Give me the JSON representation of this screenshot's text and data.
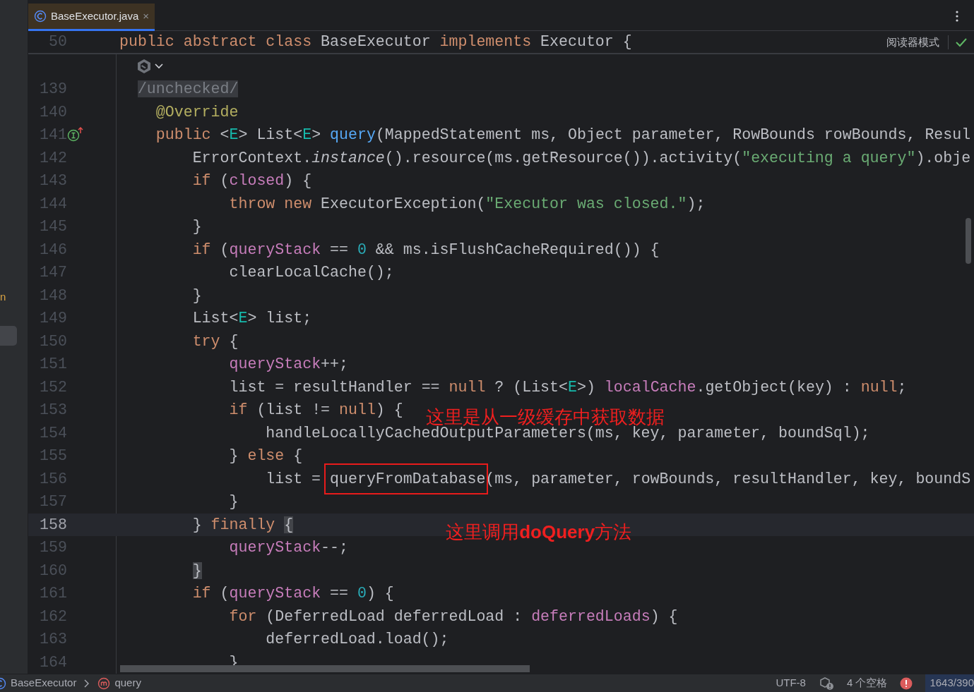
{
  "tab": {
    "title": "BaseExecutor.java",
    "close": "×",
    "selected": true
  },
  "left_panel": {
    "text": "n"
  },
  "sticky_header": {
    "line_number": "50",
    "tokens": [
      {
        "t": "public abstract class",
        "kind": "kw"
      },
      {
        "t": " BaseExecutor ",
        "kind": "plain"
      },
      {
        "t": "implements",
        "kind": "kw"
      },
      {
        "t": " Executor {",
        "kind": "plain"
      }
    ],
    "reader_mode": "阅读器模式"
  },
  "lines": [
    {
      "number": "139",
      "current": false,
      "tokens": [
        {
          "t": "/unchecked/",
          "kind": "fold"
        }
      ]
    },
    {
      "number": "140",
      "current": false,
      "tokens": [
        {
          "t": "@Override",
          "kind": "annot"
        }
      ]
    },
    {
      "number": "141",
      "current": false,
      "gutter_icon": {
        "kind": "implements"
      },
      "tokens": [
        {
          "t": "public",
          "kind": "kw"
        },
        {
          "t": " <",
          "kind": "plain"
        },
        {
          "t": "E",
          "kind": "tparam"
        },
        {
          "t": "> List<",
          "kind": "plain"
        },
        {
          "t": "E",
          "kind": "tparam"
        },
        {
          "t": "> ",
          "kind": "plain"
        },
        {
          "t": "query",
          "kind": "method"
        },
        {
          "t": "(MappedStatement ms, Object parameter, RowBounds rowBounds, Resul",
          "kind": "plain"
        }
      ],
      "children": [
        {
          "number": "142",
          "current": false,
          "tokens": [
            {
              "t": "ErrorContext.",
              "kind": "plain"
            },
            {
              "t": "instance",
              "kind": "italic"
            },
            {
              "t": "().resource(ms.getResource()).activity(",
              "kind": "plain"
            },
            {
              "t": "\"executing a query\"",
              "kind": "str"
            },
            {
              "t": ").obje",
              "kind": "plain"
            }
          ]
        },
        {
          "number": "143",
          "current": false,
          "tokens": [
            {
              "t": "if",
              "kind": "kw"
            },
            {
              "t": " (",
              "kind": "plain"
            },
            {
              "t": "closed",
              "kind": "field"
            },
            {
              "t": ") {",
              "kind": "plain"
            }
          ],
          "children": [
            {
              "number": "144",
              "current": false,
              "tokens": [
                {
                  "t": "throw new",
                  "kind": "kw"
                },
                {
                  "t": " ExecutorException(",
                  "kind": "plain"
                },
                {
                  "t": "\"Executor was closed.\"",
                  "kind": "str"
                },
                {
                  "t": ");",
                  "kind": "plain"
                }
              ]
            }
          ]
        },
        {
          "number": "145",
          "current": false,
          "tokens": [
            {
              "t": "}",
              "kind": "plain"
            }
          ]
        },
        {
          "number": "146",
          "current": false,
          "tokens": [
            {
              "t": "if",
              "kind": "kw"
            },
            {
              "t": " (",
              "kind": "plain"
            },
            {
              "t": "queryStack",
              "kind": "field"
            },
            {
              "t": " == ",
              "kind": "plain"
            },
            {
              "t": "0",
              "kind": "num"
            },
            {
              "t": " && ms.isFlushCacheRequired()) {",
              "kind": "plain"
            }
          ],
          "children": [
            {
              "number": "147",
              "current": false,
              "tokens": [
                {
                  "t": "clearLocalCache();",
                  "kind": "plain"
                }
              ]
            }
          ]
        },
        {
          "number": "148",
          "current": false,
          "tokens": [
            {
              "t": "}",
              "kind": "plain"
            }
          ]
        },
        {
          "number": "149",
          "current": false,
          "tokens": [
            {
              "t": "List<",
              "kind": "plain"
            },
            {
              "t": "E",
              "kind": "tparam"
            },
            {
              "t": "> list;",
              "kind": "plain"
            }
          ]
        },
        {
          "number": "150",
          "current": false,
          "tokens": [
            {
              "t": "try",
              "kind": "kw"
            },
            {
              "t": " {",
              "kind": "plain"
            }
          ],
          "children": [
            {
              "number": "151",
              "current": false,
              "tokens": [
                {
                  "t": "queryStack",
                  "kind": "field"
                },
                {
                  "t": "++;",
                  "kind": "plain"
                }
              ]
            },
            {
              "number": "152",
              "current": false,
              "tokens": [
                {
                  "t": "list = resultHandler == ",
                  "kind": "plain"
                },
                {
                  "t": "null",
                  "kind": "kw"
                },
                {
                  "t": " ? (List<",
                  "kind": "plain"
                },
                {
                  "t": "E",
                  "kind": "tparam"
                },
                {
                  "t": ">) ",
                  "kind": "plain"
                },
                {
                  "t": "localCache",
                  "kind": "field"
                },
                {
                  "t": ".getObject(key) : ",
                  "kind": "plain"
                },
                {
                  "t": "null",
                  "kind": "kw"
                },
                {
                  "t": ";",
                  "kind": "plain"
                }
              ]
            },
            {
              "number": "153",
              "current": false,
              "tokens": [
                {
                  "t": "if",
                  "kind": "kw"
                },
                {
                  "t": " (list != ",
                  "kind": "plain"
                },
                {
                  "t": "null",
                  "kind": "kw"
                },
                {
                  "t": ") {",
                  "kind": "plain"
                }
              ],
              "note": "这里是从一级缓存中获取数据",
              "children": [
                {
                  "number": "154",
                  "current": false,
                  "tokens": [
                    {
                      "t": "handleLocallyCachedOutputParameters(ms, key, parameter, boundSql);",
                      "kind": "plain"
                    }
                  ]
                }
              ]
            },
            {
              "number": "155",
              "current": false,
              "tokens": [
                {
                  "t": "} ",
                  "kind": "plain"
                },
                {
                  "t": "else",
                  "kind": "kw"
                },
                {
                  "t": " {",
                  "kind": "plain"
                }
              ],
              "children": [
                {
                  "number": "156",
                  "current": false,
                  "tokens": [
                    {
                      "t": "list = ",
                      "kind": "plain"
                    },
                    {
                      "t": "queryFromDatabase",
                      "kind": "plain",
                      "boxed": true
                    },
                    {
                      "t": "(ms, parameter, rowBounds, resultHandler, key, boundS",
                      "kind": "plain"
                    }
                  ]
                }
              ]
            },
            {
              "number": "157",
              "current": false,
              "tokens": [
                {
                  "t": "}",
                  "kind": "plain"
                }
              ]
            }
          ]
        },
        {
          "number": "158",
          "current": true,
          "tokens": [
            {
              "t": "} ",
              "kind": "plain"
            },
            {
              "t": "finally ",
              "kind": "kw"
            },
            {
              "t": "{",
              "kind": "brace"
            }
          ],
          "note": "这里调用**doQuery**方法",
          "children": [
            {
              "number": "159",
              "current": false,
              "tokens": [
                {
                  "t": "queryStack",
                  "kind": "field"
                },
                {
                  "t": "--;",
                  "kind": "plain"
                }
              ]
            }
          ]
        },
        {
          "number": "160",
          "current": false,
          "tokens": [
            {
              "t": "}",
              "kind": "brace"
            }
          ]
        },
        {
          "number": "161",
          "current": false,
          "tokens": [
            {
              "t": "if",
              "kind": "kw"
            },
            {
              "t": " (",
              "kind": "plain"
            },
            {
              "t": "queryStack",
              "kind": "field"
            },
            {
              "t": " == ",
              "kind": "plain"
            },
            {
              "t": "0",
              "kind": "num"
            },
            {
              "t": ") {",
              "kind": "plain"
            }
          ],
          "children": [
            {
              "number": "162",
              "current": false,
              "tokens": [
                {
                  "t": "for",
                  "kind": "kw"
                },
                {
                  "t": " (DeferredLoad deferredLoad : ",
                  "kind": "plain"
                },
                {
                  "t": "deferredLoads",
                  "kind": "field"
                },
                {
                  "t": ") {",
                  "kind": "plain"
                }
              ],
              "children": [
                {
                  "number": "163",
                  "current": false,
                  "tokens": [
                    {
                      "t": "deferredLoad.load();",
                      "kind": "plain"
                    }
                  ]
                }
              ]
            },
            {
              "number": "164",
              "current": false,
              "tokens": [
                {
                  "t": "}",
                  "kind": "plain"
                }
              ]
            }
          ]
        }
      ]
    }
  ],
  "status_bar": {
    "breadcrumbs": [
      {
        "kind": "class",
        "label": "BaseExecutor"
      },
      {
        "kind": "method",
        "label": "query"
      }
    ],
    "encoding": "UTF-8",
    "indent": "4 个空格",
    "position": "1643/390"
  }
}
